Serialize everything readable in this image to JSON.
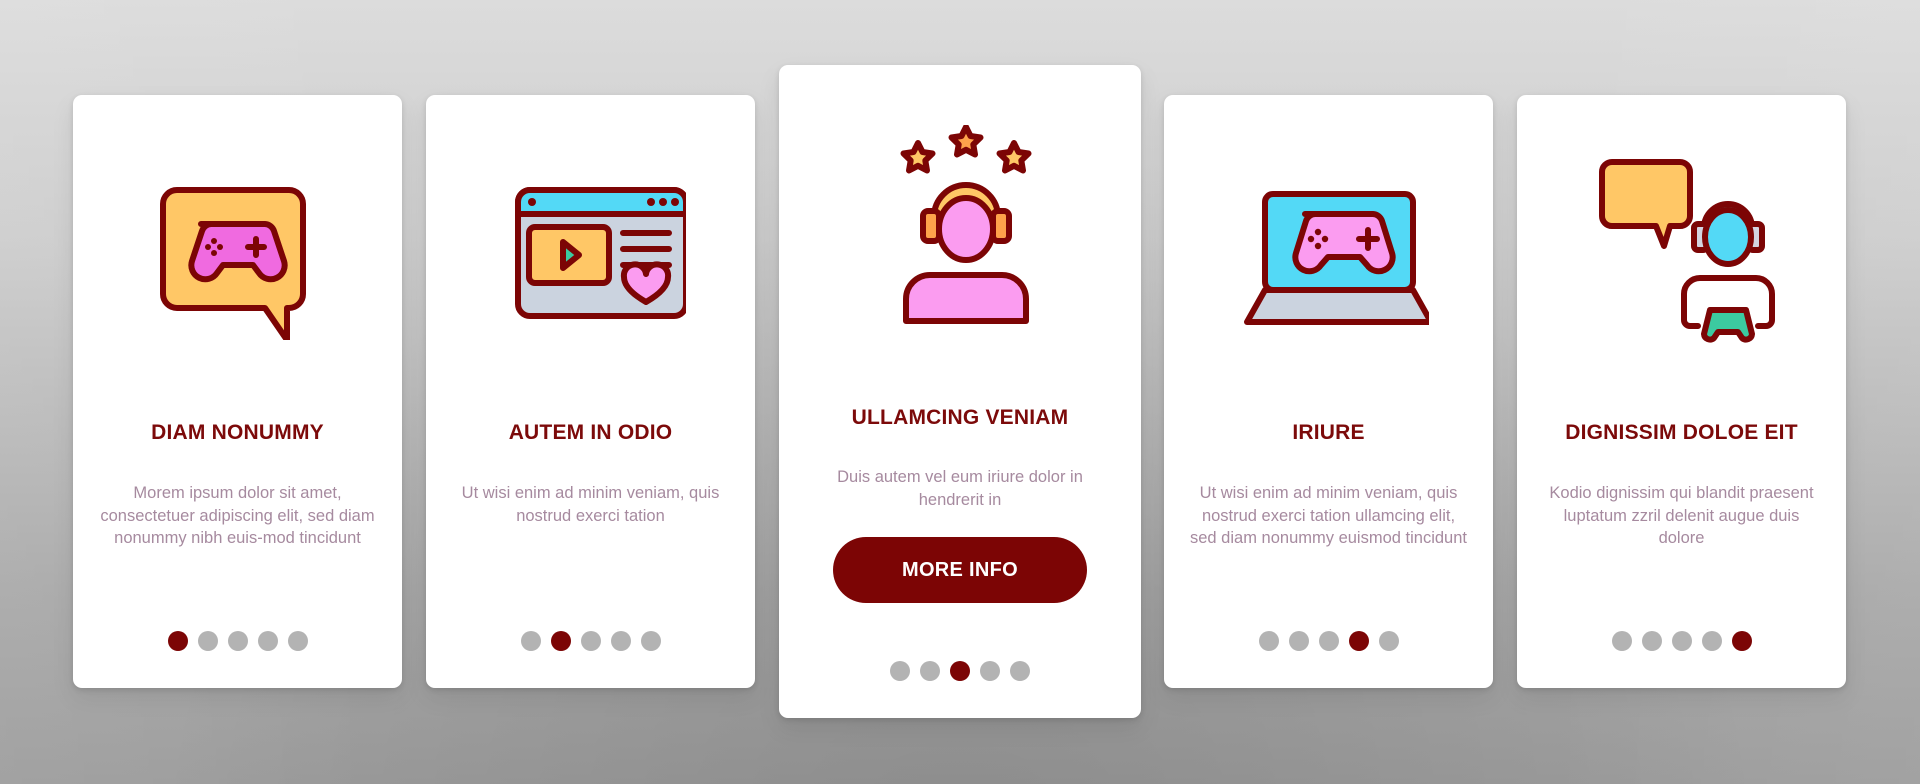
{
  "colors": {
    "accent": "#7c0505",
    "title": "#7c0a0a",
    "body_text": "#a68a9f",
    "dot_inactive": "#b3b3b3",
    "icon_stroke": "#7c0505",
    "icon_yellow": "#ffc766",
    "icon_pink": "#fb9cf0",
    "icon_magenta": "#f06ae0",
    "icon_cyan": "#53d9f6",
    "icon_gray": "#cbd3df",
    "icon_green": "#3ccaa0",
    "icon_orange": "#fea24b"
  },
  "cards": [
    {
      "icon": "gamepad-chat-bubble-icon",
      "title": "DIAM NONUMMY",
      "body": "Morem ipsum dolor sit amet, consectetuer adipiscing elit, sed diam nonummy nibh euis-mod tincidunt",
      "active_dot": 1
    },
    {
      "icon": "video-browser-heart-icon",
      "title": "AUTEM IN ODIO",
      "body": "Ut wisi enim ad minim veniam, quis nostrud exerci tation",
      "active_dot": 2
    },
    {
      "icon": "gamer-headset-stars-icon",
      "title": "ULLAMCING VENIAM",
      "body": "Duis autem vel eum iriure dolor in hendrerit in",
      "button_label": "MORE INFO",
      "active_dot": 3
    },
    {
      "icon": "laptop-gamepad-icon",
      "title": "IRIURE",
      "body": "Ut wisi enim ad minim veniam, quis nostrud exerci tation ullamcing elit, sed diam nonummy euismod tincidunt",
      "active_dot": 4
    },
    {
      "icon": "gamer-chat-controller-icon",
      "title": "DIGNISSIM DOLOE EIT",
      "body": "Kodio dignissim qui blandit praesent luptatum zzril delenit augue duis dolore",
      "active_dot": 5
    }
  ],
  "pagination": {
    "total_pages": 5
  }
}
